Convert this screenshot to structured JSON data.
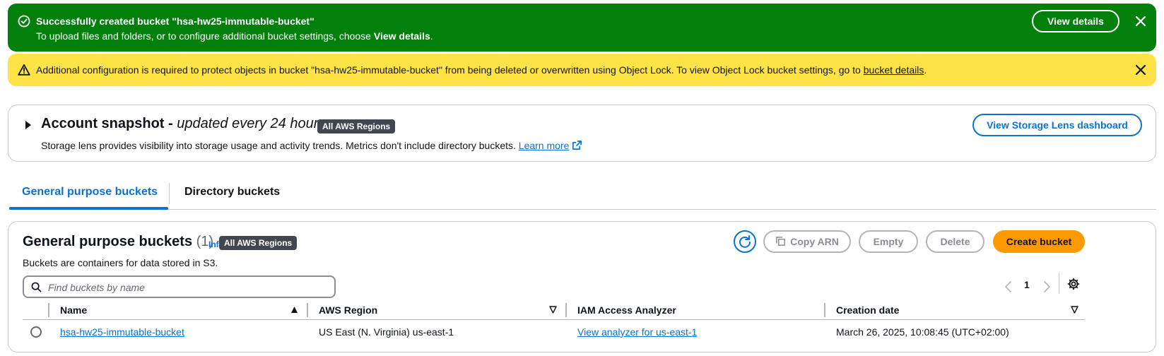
{
  "success_flash": {
    "title": "Successfully created bucket \"hsa-hw25-immutable-bucket\"",
    "message_prefix": "To upload files and folders, or to configure additional bucket settings, choose ",
    "message_bold": "View details",
    "message_suffix": ".",
    "button_label": "View details"
  },
  "warning_flash": {
    "message": "Additional configuration is required to protect objects in bucket \"hsa-hw25-immutable-bucket\" from being deleted or overwritten using Object Lock. To view Object Lock bucket settings, go to ",
    "link_text": "bucket details",
    "suffix": "."
  },
  "snapshot": {
    "title": "Account snapshot - ",
    "title_italic": "updated every 24 hours",
    "badge": "All AWS Regions",
    "description": "Storage lens provides visibility into storage usage and activity trends. Metrics don't include directory buckets. ",
    "learn_more": "Learn more",
    "button_label": "View Storage Lens dashboard"
  },
  "tabs": [
    {
      "label": "General purpose buckets",
      "active": true
    },
    {
      "label": "Directory buckets",
      "active": false
    }
  ],
  "panel": {
    "title": "General purpose buckets",
    "count": "(1)",
    "info": "Info",
    "badge": "All AWS Regions",
    "subtitle": "Buckets are containers for data stored in S3.",
    "buttons": {
      "copy_arn": "Copy ARN",
      "empty": "Empty",
      "delete": "Delete",
      "create": "Create bucket"
    },
    "search_placeholder": "Find buckets by name",
    "page": "1",
    "columns": [
      "Name",
      "AWS Region",
      "IAM Access Analyzer",
      "Creation date"
    ],
    "rows": [
      {
        "name": "hsa-hw25-immutable-bucket",
        "region": "US East (N. Virginia) us-east-1",
        "analyzer": "View analyzer for us-east-1",
        "created": "March 26, 2025, 10:08:45 (UTC+02:00)"
      }
    ]
  },
  "colors": {
    "success": "#037f0c",
    "warning": "#ffe347",
    "link": "#0972d3",
    "primary_button": "#ff9900",
    "badge": "#424650"
  },
  "icons": [
    "check-circle-icon",
    "close-icon",
    "warning-icon",
    "caret-right-icon",
    "external-link-icon",
    "refresh-icon",
    "copy-icon",
    "search-icon",
    "chevron-left-icon",
    "chevron-right-icon",
    "settings-icon",
    "sort-ascending-icon",
    "sort-descending-icon"
  ]
}
